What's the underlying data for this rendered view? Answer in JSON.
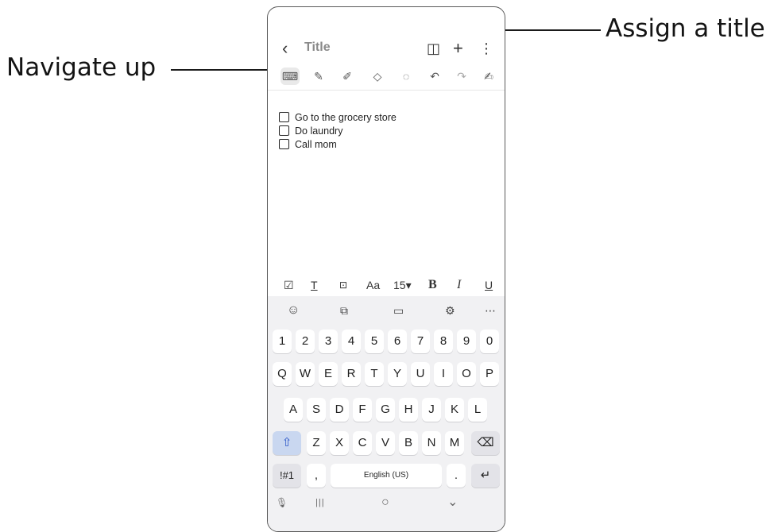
{
  "callouts": {
    "navigate_up": "Navigate up",
    "assign_title": "Assign a title"
  },
  "header": {
    "back_glyph": "‹",
    "title_placeholder": "Title",
    "book_glyph": "◫",
    "add_glyph": "+",
    "more_glyph": "⋮"
  },
  "pen_toolbar": [
    {
      "name": "keyboard",
      "glyph": "⌨"
    },
    {
      "name": "pen",
      "glyph": "✎"
    },
    {
      "name": "highlighter",
      "glyph": "✐"
    },
    {
      "name": "eraser",
      "glyph": "◇"
    },
    {
      "name": "lasso",
      "glyph": "◌"
    },
    {
      "name": "undo",
      "glyph": "↶"
    },
    {
      "name": "redo",
      "glyph": "↷"
    },
    {
      "name": "pen-settings",
      "glyph": "✍"
    }
  ],
  "notes": [
    "Go to the grocery store",
    "Do laundry",
    "Call mom"
  ],
  "format_bar": {
    "checkbox": "☑",
    "text_color": "T",
    "text_box": "⊡",
    "font": "Aa",
    "font_size": "15▾",
    "bold": "B",
    "italic": "I",
    "underline": "U"
  },
  "keyboard_toolbar": {
    "emoji": "☺",
    "translate": "⧉",
    "clipboard": "▭",
    "settings": "⚙",
    "more": "⋯"
  },
  "keyboard": {
    "row_numbers": [
      "1",
      "2",
      "3",
      "4",
      "5",
      "6",
      "7",
      "8",
      "9",
      "0"
    ],
    "row_q": [
      "Q",
      "W",
      "E",
      "R",
      "T",
      "Y",
      "U",
      "I",
      "O",
      "P"
    ],
    "row_a": [
      "A",
      "S",
      "D",
      "F",
      "G",
      "H",
      "J",
      "K",
      "L"
    ],
    "row_z": [
      "Z",
      "X",
      "C",
      "V",
      "B",
      "N",
      "M"
    ],
    "shift": "⇧",
    "backspace": "⌫",
    "symbols": "!#1",
    "comma": ",",
    "space": "English (US)",
    "period": ".",
    "enter": "↵"
  },
  "nav_bar": {
    "mic": "🎙",
    "recents": "|||",
    "home": "○",
    "hide": "⌄"
  }
}
